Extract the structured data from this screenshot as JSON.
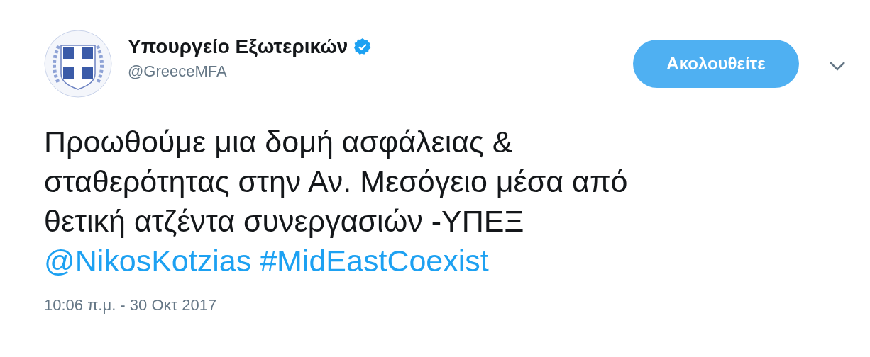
{
  "author": {
    "name": "Υπουργείο Εξωτερικών",
    "verified": true,
    "handle": "@GreeceMFA"
  },
  "follow_button": {
    "label": "Ακολουθείτε"
  },
  "tweet": {
    "text": "Προωθούμε μια δομή ασφάλειας & σταθερότητας στην Αν. Μεσόγειο μέσα από θετική ατζέντα συνεργασιών -ΥΠΕΞ",
    "links": [
      "@NikosKotzias",
      "#MidEastCoexist"
    ]
  },
  "timestamp": "10:06 π.μ. - 30 Οκτ 2017"
}
